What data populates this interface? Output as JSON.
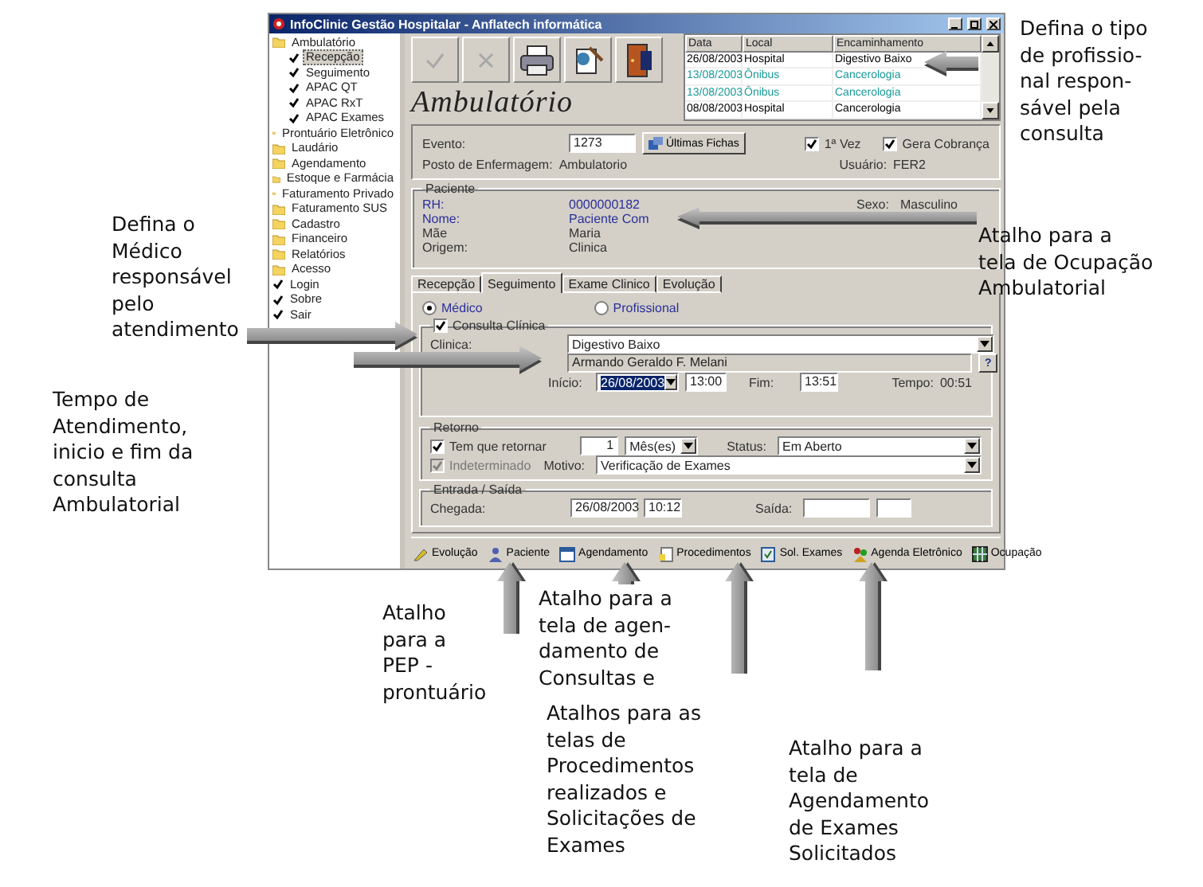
{
  "window": {
    "title": "InfoClinic Gestão Hospitalar - Anflatech informática"
  },
  "tree": [
    {
      "label": "Ambulatório",
      "kind": "folder",
      "selected": false,
      "children": [
        {
          "label": "Recepção",
          "kind": "action",
          "selected": true
        },
        {
          "label": "Seguimento",
          "kind": "action",
          "selected": false
        },
        {
          "label": "APAC QT",
          "kind": "action",
          "selected": false
        },
        {
          "label": "APAC RxT",
          "kind": "action",
          "selected": false
        },
        {
          "label": "APAC Exames",
          "kind": "action",
          "selected": false
        }
      ]
    },
    {
      "label": "Prontuário Eletrônico",
      "kind": "folder",
      "selected": false
    },
    {
      "label": "Laudário",
      "kind": "folder",
      "selected": false
    },
    {
      "label": "Agendamento",
      "kind": "folder",
      "selected": false
    },
    {
      "label": "Estoque e Farmácia",
      "kind": "folder",
      "selected": false
    },
    {
      "label": "Faturamento Privado",
      "kind": "folder",
      "selected": false
    },
    {
      "label": "Faturamento SUS",
      "kind": "folder",
      "selected": false
    },
    {
      "label": "Cadastro",
      "kind": "folder",
      "selected": false
    },
    {
      "label": "Financeiro",
      "kind": "folder",
      "selected": false
    },
    {
      "label": "Relatórios",
      "kind": "folder",
      "selected": false
    },
    {
      "label": "Acesso",
      "kind": "folder",
      "selected": false
    },
    {
      "label": "Login",
      "kind": "action",
      "selected": false
    },
    {
      "label": "Sobre",
      "kind": "action",
      "selected": false
    },
    {
      "label": "Sair",
      "kind": "action",
      "selected": false
    }
  ],
  "module_title": "Ambulatório",
  "history_table": {
    "columns": [
      "Data",
      "Local",
      "Encaminhamento"
    ],
    "rows": [
      {
        "cells": [
          "26/08/2003",
          "Hospital",
          "Digestivo Baixo"
        ],
        "color": "#000000"
      },
      {
        "cells": [
          "13/08/2003",
          "Ônibus",
          "Cancerologia"
        ],
        "color": "#1a9a9a"
      },
      {
        "cells": [
          "13/08/2003",
          "Ônibus",
          "Cancerologia"
        ],
        "color": "#1a9a9a"
      },
      {
        "cells": [
          "08/08/2003",
          "Hospital",
          "Cancerologia"
        ],
        "color": "#000000"
      }
    ]
  },
  "evento": {
    "label": "Evento:",
    "value": "1273",
    "button": "Últimas Fichas",
    "checks": [
      {
        "label": "1ª Vez",
        "checked": true
      },
      {
        "label": "Gera Cobrança",
        "checked": true
      }
    ],
    "posto_label": "Posto de Enfermagem:",
    "posto_value": "Ambulatorio",
    "usuario_label": "Usuário:",
    "usuario_value": "FER2"
  },
  "paciente": {
    "title": "Paciente",
    "fields": [
      {
        "label": "RH:",
        "value": "0000000182",
        "color": "#2b2f9a"
      },
      {
        "label": "Nome:",
        "value": "Paciente Com",
        "color": "#2b2f9a"
      },
      {
        "label": "Mãe",
        "value": "Maria",
        "color": "#333333"
      },
      {
        "label": "Origem:",
        "value": "Clinica",
        "color": "#333333"
      }
    ],
    "sexo_label": "Sexo:",
    "sexo_value": "Masculino"
  },
  "tabs": [
    {
      "label": "Recepção",
      "selected": false
    },
    {
      "label": "Seguimento",
      "selected": true
    },
    {
      "label": "Exame Clinico",
      "selected": false
    },
    {
      "label": "Evolução",
      "selected": false
    }
  ],
  "professional_type": [
    {
      "label": "Médico",
      "selected": true
    },
    {
      "label": "Profissional",
      "selected": false
    }
  ],
  "consulta": {
    "title": "Consulta Clínica",
    "checked": true,
    "clinica_label": "Clinica:",
    "clinica_value": "Digestivo Baixo",
    "medico_value": "Armando Geraldo F. Melani",
    "help": "?",
    "inicio_label": "Início:",
    "inicio_date": "26/08/2003",
    "inicio_time": "13:00",
    "fim_label": "Fim:",
    "fim_time": "13:51",
    "tempo_label": "Tempo:",
    "tempo_value": "00:51"
  },
  "retorno": {
    "title": "Retorno",
    "return_check": {
      "label": "Tem que retornar",
      "checked": true,
      "disabled": false
    },
    "quantity": "1",
    "unit": "Mês(es)",
    "status_label": "Status:",
    "status_value": "Em Aberto",
    "indeterminate_check": {
      "label": "Indeterminado",
      "checked": true,
      "disabled": true
    },
    "motivo_label": "Motivo:",
    "motivo_value": "Verificação de Exames"
  },
  "entrada_saida": {
    "title": "Entrada / Saída",
    "chegada_label": "Chegada:",
    "chegada_date": "26/08/2003",
    "chegada_time": "10:12",
    "saida_label": "Saída:"
  },
  "shortcuts": [
    {
      "label": "Evolução",
      "kind": "evolution"
    },
    {
      "label": "Paciente",
      "kind": "patient"
    },
    {
      "label": "Agendamento",
      "kind": "schedule"
    },
    {
      "label": "Procedimentos",
      "kind": "procedures"
    },
    {
      "label": "Sol. Exames",
      "kind": "exams"
    },
    {
      "label": "Agenda Eletrônico",
      "kind": "agenda"
    },
    {
      "label": "Ocupação",
      "kind": "occupancy"
    }
  ],
  "annotations": [
    {
      "text": "Defina o tipo\nde profissio-\nnal respon-\nsável pela\nconsulta"
    },
    {
      "text": "Atalho para a\ntela de Ocupação\nAmbulatorial"
    },
    {
      "text": "Defina o\nMédico\nresponsável\npelo\natendimento"
    },
    {
      "text": "Tempo de\nAtendimento,\ninicio e fim da\nconsulta\nAmbulatorial"
    },
    {
      "text": "Atalho\npara a\nPEP -\nprontuário"
    },
    {
      "text": "Atalho para a\ntela de agen-\ndamento de\nConsultas e"
    },
    {
      "text": "Atalhos para as\ntelas de\nProcedimentos\nrealizados e\nSolicitações de\nExames"
    },
    {
      "text": "Atalho para a\ntela de\nAgendamento\nde Exames\nSolicitados"
    }
  ]
}
